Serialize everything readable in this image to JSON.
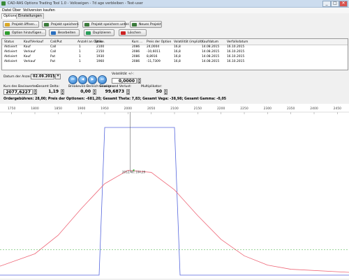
{
  "window": {
    "title": "CAD-RAS Options Trading Tool 1.0 - Volkseigen - 7d age verbleiben - Test-user",
    "min": "_",
    "max": "□",
    "close": "✕"
  },
  "menu": [
    "Datei",
    "Über",
    "Vollversion kaufen"
  ],
  "tabs": [
    "Optionen",
    "Einstellungen"
  ],
  "toolbar": {
    "row1": [
      {
        "label": "Projekt öffnen...",
        "icon": "folder-open-icon",
        "color": "#d9a825"
      },
      {
        "label": "Projekt speichern",
        "icon": "save-icon",
        "color": "#3a7a3a"
      },
      {
        "label": "Projekt speichern unter...",
        "icon": "save-as-icon",
        "color": "#3a7a3a"
      },
      {
        "label": "Neues Projekt",
        "icon": "new-project-icon",
        "color": "#3a7a3a"
      }
    ],
    "row2": [
      {
        "label": "Option hinzufügen...",
        "icon": "add-icon",
        "color": "#2e9e2e"
      },
      {
        "label": "Bearbeiten",
        "icon": "edit-icon",
        "color": "#2a6fbf"
      },
      {
        "label": "Duplizieren",
        "icon": "duplicate-icon",
        "color": "#2a9e5a"
      },
      {
        "label": "Löschen",
        "icon": "delete-icon",
        "color": "#cc2222"
      }
    ]
  },
  "table": {
    "columns": [
      "Status",
      "Kauf/Verkauf",
      "Call/Put",
      "Anzahl an Optio...",
      "Strike",
      "Kurs ...",
      "Preis der Option",
      "Volatilität (implizit)",
      "Kaufdatum",
      "Verfallsdatum"
    ],
    "rows": [
      [
        "Aktiviert",
        "Kauf",
        "Call",
        "1",
        "2100",
        "2086",
        "24,0004",
        "16,8",
        "14.08.2015",
        "16.10.2015"
      ],
      [
        "Aktiviert",
        "Verkauf",
        "Call",
        "1",
        "2150",
        "2086",
        "-10,6011",
        "16,8",
        "14.08.2015",
        "16.10.2015"
      ],
      [
        "Aktiviert",
        "Kauf",
        "Put",
        "1",
        "1930",
        "2086",
        "8,8916",
        "16,8",
        "14.08.2015",
        "16.10.2015"
      ],
      [
        "Aktiviert",
        "Verkauf",
        "Put",
        "1",
        "1960",
        "2086",
        "-11,7309",
        "16,8",
        "14.08.2015",
        "16.10.2015"
      ]
    ]
  },
  "controls": {
    "date_label": "Datum der Anzeige:",
    "date_value": "02.09.2015",
    "volatility_label": "Volatilität +/-:",
    "volatility_value": "0,0000",
    "base_price_label": "Kurs des Basiswertes:",
    "base_price_value": "2077,6227",
    "total_delta_label": "Gesamt Delta:",
    "total_delta_value": "1,19",
    "range_label": "Breakeven-Bereich anzeigen:",
    "range_value": "0,00",
    "profit_label": "Gewinn und Verlust:",
    "profit_value": "99,6873",
    "multiplier_label": "Multiplikator:",
    "multiplier_value": "50",
    "nav_icons": [
      "first-icon",
      "previous-icon",
      "next-icon",
      "last-icon"
    ],
    "nav_glyphs": [
      "⏮",
      "◀",
      "▶",
      "⏭"
    ]
  },
  "summary": "Ordergebühren: 28,00; Preis der Optionen: -681,20; Gesamt Theta: 7,83; Gesamt Vega: -38,98; Gesamt Gamma: -0,05",
  "chart_data": {
    "type": "line",
    "x_ticks": [
      "1750",
      "1800",
      "1850",
      "1900",
      "1950",
      "2000",
      "2050",
      "2100",
      "2150",
      "2200",
      "2250",
      "2300",
      "2350",
      "2400",
      "2450"
    ],
    "xlim": [
      1725,
      2475
    ],
    "vertical_marker_x": 2005,
    "point_label": "2012,40; 104,29",
    "point": {
      "x": 2012.4,
      "y": 104.29
    },
    "series": [
      {
        "color": "#5566dd",
        "x": [
          1725,
          1938,
          1950,
          2100,
          2112,
          2475
        ],
        "y": [
          -5,
          -5,
          1,
          1,
          -5,
          -5
        ]
      },
      {
        "color": "#ee6677",
        "x": [
          1725,
          1800,
          1850,
          1900,
          1950,
          2000,
          2050,
          2100,
          2150,
          2200,
          2250,
          2300,
          2350,
          2475
        ],
        "y": [
          0.06,
          0.18,
          0.36,
          0.62,
          0.86,
          0.99,
          0.97,
          0.8,
          0.55,
          0.32,
          0.16,
          0.07,
          0.03,
          0.0
        ]
      },
      {
        "color": "#33aa33",
        "x": [
          1725,
          2475
        ],
        "y": [
          0.22,
          0.22
        ]
      }
    ]
  }
}
